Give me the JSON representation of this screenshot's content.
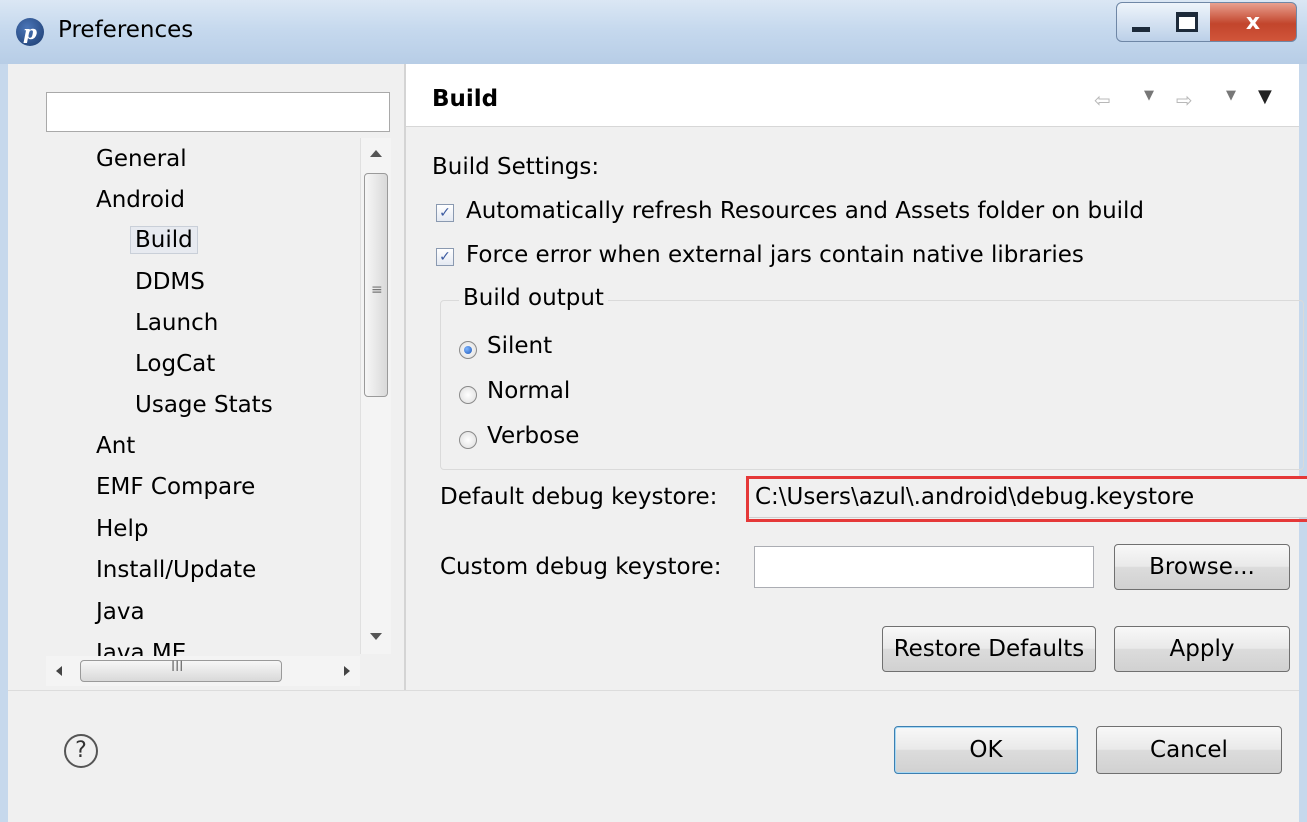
{
  "window": {
    "title": "Preferences",
    "logo_letter": "p",
    "close_glyph": "x"
  },
  "filter": {
    "value": ""
  },
  "tree": {
    "items": [
      {
        "label": "General",
        "level": 0
      },
      {
        "label": "Android",
        "level": 0
      },
      {
        "label": "Build",
        "level": 1,
        "selected": true
      },
      {
        "label": "DDMS",
        "level": 1
      },
      {
        "label": "Launch",
        "level": 1
      },
      {
        "label": "LogCat",
        "level": 1
      },
      {
        "label": "Usage Stats",
        "level": 1
      },
      {
        "label": "Ant",
        "level": 0
      },
      {
        "label": "EMF Compare",
        "level": 0
      },
      {
        "label": "Help",
        "level": 0
      },
      {
        "label": "Install/Update",
        "level": 0
      },
      {
        "label": "Java",
        "level": 0
      },
      {
        "label": "Java ME",
        "level": 0
      }
    ],
    "vscroll_grip": "≡",
    "hscroll_grip": "III"
  },
  "page": {
    "title": "Build",
    "nav_back": "⇦",
    "nav_forward": "⇨",
    "dropdown_glyph": "▼",
    "build_settings_label": "Build Settings:",
    "checkboxes": [
      {
        "label": "Automatically refresh Resources and Assets folder on build",
        "checked": true
      },
      {
        "label": "Force error when external jars contain native libraries",
        "checked": true
      }
    ],
    "build_output": {
      "legend": "Build output",
      "options": [
        "Silent",
        "Normal",
        "Verbose"
      ],
      "selected": "Silent"
    },
    "default_keystore_label": "Default debug keystore:",
    "default_keystore_value": "C:\\Users\\azul\\.android\\debug.keystore",
    "custom_keystore_label": "Custom debug keystore:",
    "custom_keystore_value": "",
    "browse_label": "Browse...",
    "restore_defaults_label": "Restore Defaults",
    "apply_label": "Apply",
    "checkmark_glyph": "✓"
  },
  "footer": {
    "help_glyph": "?",
    "ok_label": "OK",
    "cancel_label": "Cancel"
  },
  "colors": {
    "highlight": "#e53838",
    "titlebar": "#c6d9ee",
    "close_button": "#c2452c"
  }
}
